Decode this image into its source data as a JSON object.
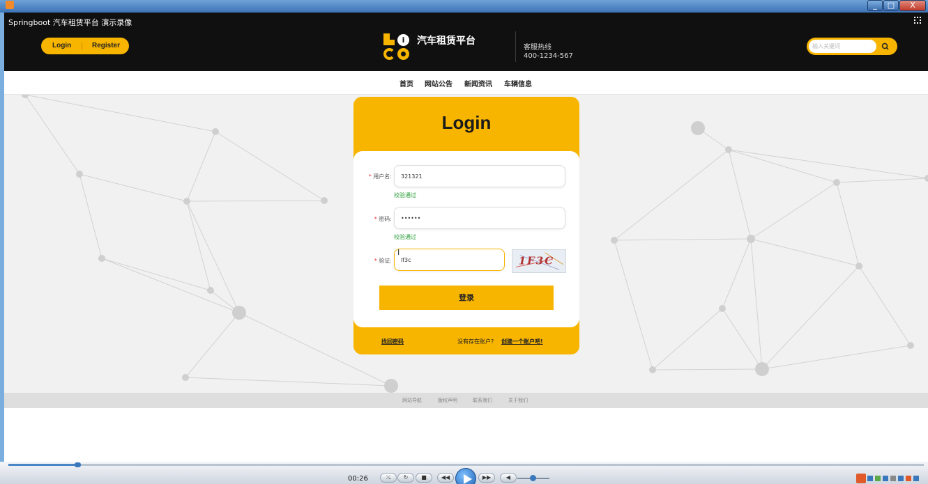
{
  "window": {
    "buttons": [
      "_",
      "□",
      "X"
    ]
  },
  "player": {
    "title": "Springboot 汽车租赁平台 演示录像",
    "time": "00:26",
    "progress": 0.075
  },
  "header": {
    "login_label": "Login",
    "register_label": "Register",
    "site_name": "汽车租赁平台",
    "logo_text": "LOGO",
    "hotline_label": "客服热线",
    "hotline_number": "400-1234-567",
    "search_placeholder": "输入关键词"
  },
  "nav": {
    "items": [
      "首页",
      "网站公告",
      "新闻资讯",
      "车辆信息"
    ]
  },
  "login": {
    "title": "Login",
    "username_label": "用户名:",
    "username_value": "321321",
    "username_status": "校验通过",
    "password_label": "密码:",
    "password_value": "••••••",
    "password_status": "校验通过",
    "captcha_label": "验证:",
    "captcha_value": "lf3c",
    "captcha_image_text": "1F3C",
    "submit_label": "登录",
    "forgot_link": "找回密码",
    "no_account_text": "没有存在账户?",
    "create_link": "创建一个账户吧!"
  },
  "footer": {
    "links": [
      "网站导航",
      "版权声明",
      "联系我们",
      "关于我们"
    ]
  },
  "colors": {
    "accent": "#f8b500",
    "header_bg": "#101010",
    "success": "#2a9d3a"
  }
}
